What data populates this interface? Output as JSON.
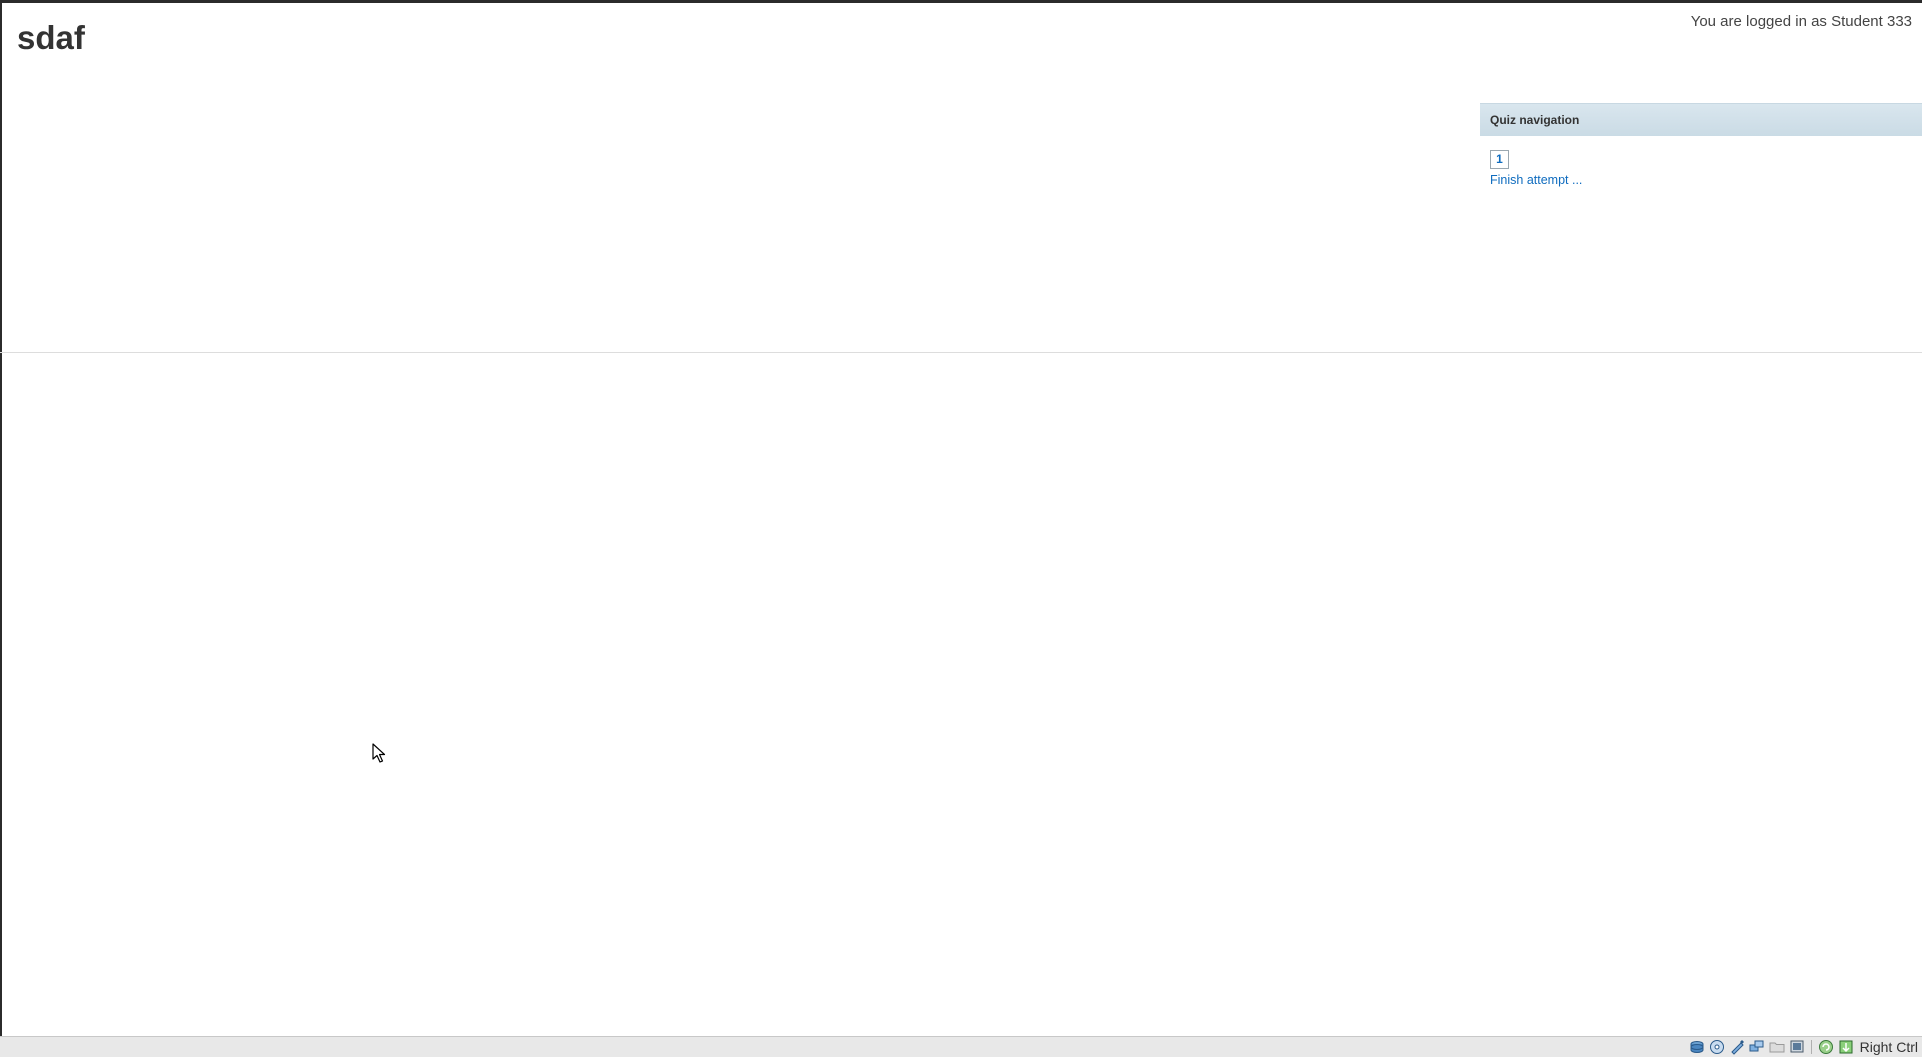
{
  "page": {
    "title": "sdaf",
    "login_info": "You are logged in as Student 333"
  },
  "quiz_navigation": {
    "title": "Quiz navigation",
    "questions": [
      {
        "label": "1"
      }
    ],
    "finish_link": "Finish attempt ..."
  },
  "statusbar": {
    "host_key": "Right Ctrl",
    "icons": [
      "hard-disk-icon",
      "optical-drive-icon",
      "usb-icon",
      "network-icon",
      "shared-folder-icon",
      "display-icon",
      "video-capture-icon",
      "mouse-integration-icon"
    ]
  },
  "colors": {
    "link": "#0f6cbf",
    "nav_header": "#d9e6ee",
    "title_text": "#333333"
  }
}
